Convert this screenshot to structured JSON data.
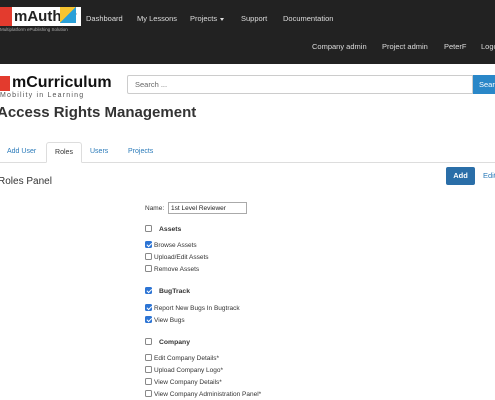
{
  "app": {
    "logo_text": "mAuthor",
    "logo_tagline": "Multiplatform ePublishing Solution"
  },
  "nav": {
    "primary": [
      {
        "label": "Dashboard"
      },
      {
        "label": "My Lessons"
      },
      {
        "label": "Projects"
      },
      {
        "label": "Support"
      },
      {
        "label": "Documentation"
      }
    ],
    "secondary": [
      {
        "label": "Company admin"
      },
      {
        "label": "Project admin"
      },
      {
        "label": "PeterF"
      },
      {
        "label": "Logout"
      }
    ]
  },
  "brand": {
    "name": "mCurriculum",
    "tagline": "Mobility in Learning"
  },
  "search": {
    "placeholder": "Search ...",
    "button_label": "Search"
  },
  "page": {
    "title": "Access Rights Management"
  },
  "tabs": [
    {
      "label": "Add User",
      "active": false
    },
    {
      "label": "Roles",
      "active": true
    },
    {
      "label": "Users",
      "active": false
    },
    {
      "label": "Projects",
      "active": false
    }
  ],
  "panel": {
    "title": "Roles Panel",
    "add_label": "Add",
    "edit_label": "Edit"
  },
  "form": {
    "name_label": "Name:",
    "name_value": "1st Level Reviewer"
  },
  "permission_groups": [
    {
      "label": "Assets",
      "checked": false,
      "items": [
        {
          "label": "Browse Assets",
          "checked": true
        },
        {
          "label": "Upload/Edit Assets",
          "checked": false
        },
        {
          "label": "Remove Assets",
          "checked": false
        }
      ]
    },
    {
      "label": "BugTrack",
      "checked": true,
      "items": [
        {
          "label": "Report New Bugs In Bugtrack",
          "checked": true
        },
        {
          "label": "View Bugs",
          "checked": true
        }
      ]
    },
    {
      "label": "Company",
      "checked": false,
      "items": [
        {
          "label": "Edit Company Details*",
          "checked": false
        },
        {
          "label": "Upload Company Logo*",
          "checked": false
        },
        {
          "label": "View Company Details*",
          "checked": false
        },
        {
          "label": "View Company Administration Panel*",
          "checked": false
        }
      ]
    }
  ],
  "colors": {
    "navbar": "#222222",
    "primary_button": "#2a6ea8",
    "link": "#2a7ab9",
    "checkbox_checked": "#2c74d4"
  }
}
